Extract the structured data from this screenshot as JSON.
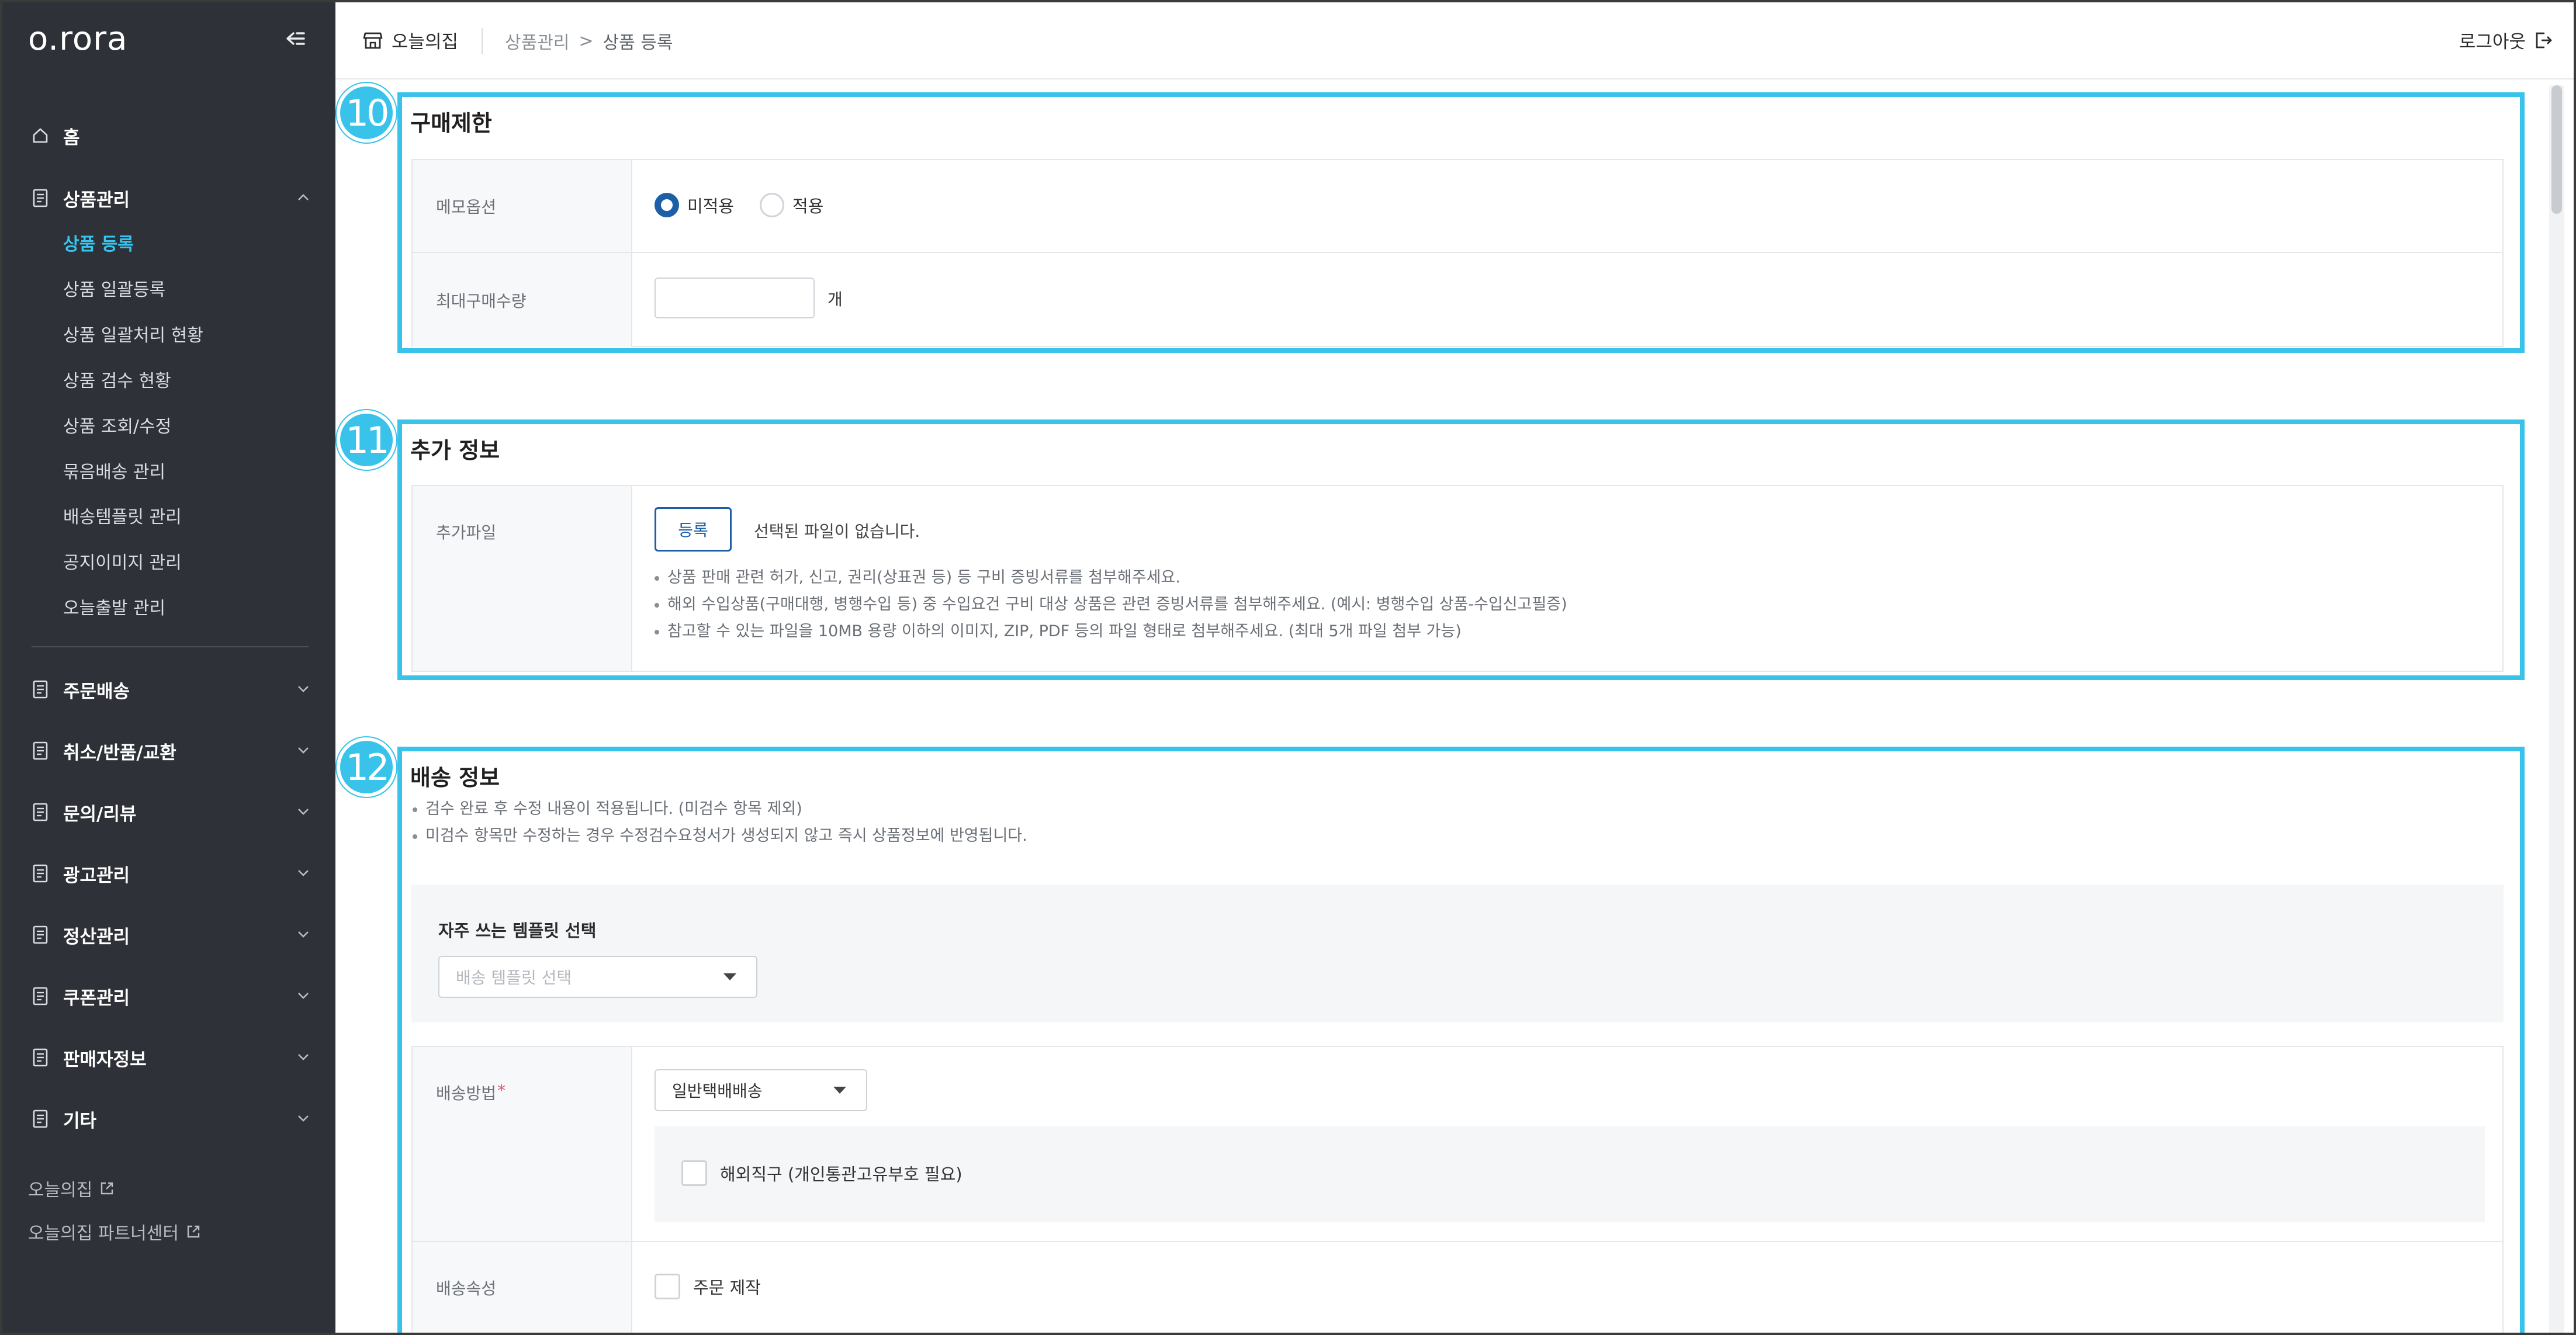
{
  "sidebar": {
    "logo": "o.rora",
    "home": "홈",
    "groups": [
      {
        "label": "상품관리",
        "expanded": true
      },
      {
        "label": "주문배송"
      },
      {
        "label": "취소/반품/교환"
      },
      {
        "label": "문의/리뷰"
      },
      {
        "label": "광고관리"
      },
      {
        "label": "정산관리"
      },
      {
        "label": "쿠폰관리"
      },
      {
        "label": "판매자정보"
      },
      {
        "label": "기타"
      }
    ],
    "product_sub_items": [
      {
        "label": "상품 등록",
        "active": true
      },
      {
        "label": "상품 일괄등록"
      },
      {
        "label": "상품 일괄처리 현황"
      },
      {
        "label": "상품 검수 현황"
      },
      {
        "label": "상품 조회/수정"
      },
      {
        "label": "묶음배송 관리"
      },
      {
        "label": "배송템플릿 관리"
      },
      {
        "label": "공지이미지 관리"
      },
      {
        "label": "오늘출발 관리"
      }
    ],
    "external_links": [
      {
        "label": "오늘의집"
      },
      {
        "label": "오늘의집 파트너센터"
      }
    ]
  },
  "header": {
    "store_name": "오늘의집",
    "breadcrumb": [
      "상품관리",
      "상품 등록"
    ],
    "breadcrumb_sep": ">",
    "logout": "로그아웃"
  },
  "sections": {
    "purchase_limit": {
      "step": "10",
      "title": "구매제한",
      "memo_option": {
        "label": "메모옵션",
        "options": [
          "미적용",
          "적용"
        ],
        "selected": "미적용"
      },
      "max_quantity": {
        "label": "최대구매수량",
        "value": "",
        "unit": "개"
      }
    },
    "additional_info": {
      "step": "11",
      "title": "추가 정보",
      "file": {
        "label": "추가파일",
        "button": "등록",
        "status": "선택된 파일이 없습니다.",
        "notes": [
          "상품 판매 관련 허가, 신고, 권리(상표권 등) 등 구비 증빙서류를 첨부해주세요.",
          "해외 수입상품(구매대행, 병행수입 등) 중 수입요건 구비 대상 상품은 관련 증빙서류를 첨부해주세요. (예시: 병행수입 상품-수입신고필증)",
          "참고할 수 있는 파일을 10MB 용량 이하의 이미지, ZIP, PDF 등의 파일 형태로 첨부해주세요. (최대 5개 파일 첨부 가능)"
        ]
      }
    },
    "shipping_info": {
      "step": "12",
      "title": "배송 정보",
      "notes": [
        "검수 완료 후 수정 내용이 적용됩니다. (미검수 항목 제외)",
        "미검수 항목만 수정하는 경우 수정검수요청서가 생성되지 않고 즉시 상품정보에 반영됩니다."
      ],
      "template": {
        "title": "자주 쓰는 템플릿 선택",
        "placeholder": "배송 템플릿 선택"
      },
      "method": {
        "label": "배송방법",
        "required_mark": "*",
        "selected": "일반택배배송",
        "overseas_checkbox": "해외직구 (개인통관고유부호 필요)",
        "overseas_checked": false
      },
      "attribute": {
        "label": "배송속성",
        "checkbox": "주문 제작",
        "checked": false
      }
    }
  },
  "colors": {
    "sidebar_bg": "#2e3238",
    "accent": "#35c5f0",
    "primary": "#1d5fa6",
    "highlight": "#39c3ea",
    "required": "#f0445a"
  }
}
